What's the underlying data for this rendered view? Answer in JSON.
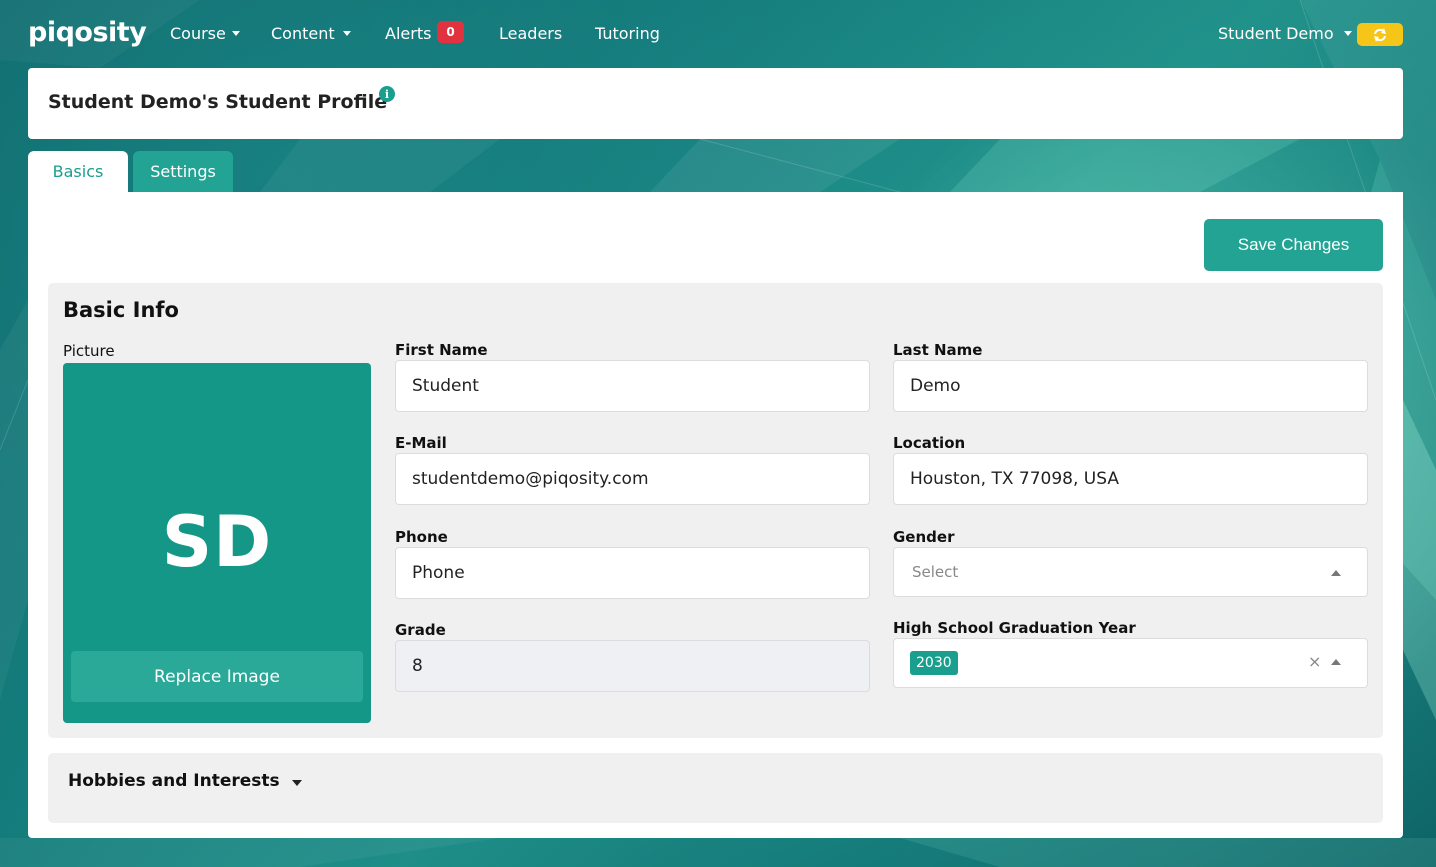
{
  "navbar": {
    "brand": "piqosity",
    "items": [
      {
        "label": "Course"
      },
      {
        "label": "Content"
      },
      {
        "label": "Alerts",
        "badge": "0"
      },
      {
        "label": "Leaders"
      },
      {
        "label": "Tutoring"
      }
    ],
    "user_menu": "Student Demo"
  },
  "header": {
    "title": "Student Demo's Student Profile",
    "info_glyph": "i"
  },
  "tabs": [
    {
      "label": "Basics",
      "active": true
    },
    {
      "label": "Settings",
      "active": false
    }
  ],
  "toolbar": {
    "save_label": "Save Changes"
  },
  "basic_info": {
    "title": "Basic Info",
    "picture_label": "Picture",
    "avatar_initials": "SD",
    "replace_label": "Replace Image",
    "first_name": {
      "label": "First Name",
      "value": "Student"
    },
    "last_name": {
      "label": "Last Name",
      "value": "Demo"
    },
    "email": {
      "label": "E-Mail",
      "value": "studentdemo@piqosity.com"
    },
    "location": {
      "label": "Location",
      "value": "Houston, TX 77098, USA"
    },
    "phone": {
      "label": "Phone",
      "value": "Phone"
    },
    "gender": {
      "label": "Gender",
      "placeholder": "Select"
    },
    "grade": {
      "label": "Grade",
      "value": "8"
    },
    "graduation": {
      "label": "High School Graduation Year",
      "chip": "2030",
      "clear": "×"
    }
  },
  "hobbies": {
    "title": "Hobbies and Interests"
  },
  "colors": {
    "accent": "#1a9e8e",
    "alert": "#e0323f",
    "sync": "#f5c518"
  }
}
